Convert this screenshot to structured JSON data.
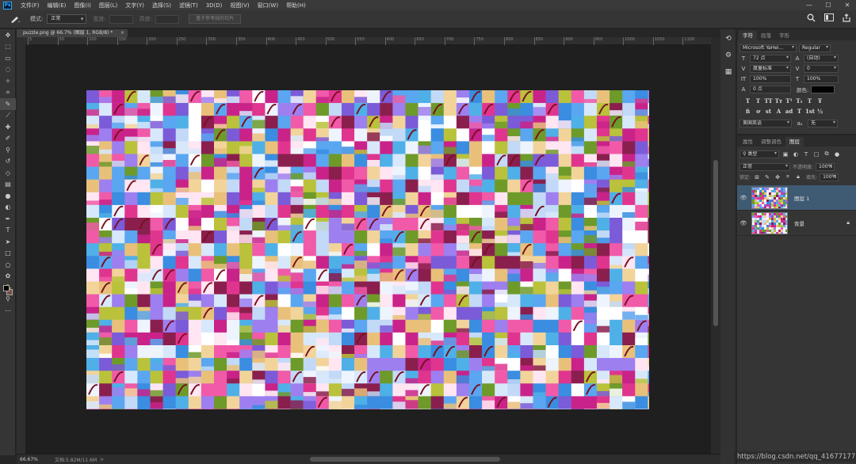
{
  "app": {
    "logo": "Ps"
  },
  "menu": [
    "文件(F)",
    "编辑(E)",
    "图像(I)",
    "图层(L)",
    "文字(Y)",
    "选择(S)",
    "滤镜(T)",
    "3D(D)",
    "视图(V)",
    "窗口(W)",
    "帮助(H)"
  ],
  "window_controls": {
    "minimize": "—",
    "maximize": "☐",
    "close": "✕"
  },
  "options": {
    "mode_label": "模式:",
    "mode_value": "正常",
    "width_label": "宽度:",
    "height_label": "高度:",
    "slices_button": "基于参考线的切片"
  },
  "document": {
    "tab_title": "puzzle.png @ 66.7% (图层 1, RGB/8) *",
    "tab_close": "×"
  },
  "ruler": {
    "h_ticks": [
      "5",
      "50",
      "100",
      "150",
      "200",
      "250",
      "300",
      "350",
      "400",
      "450",
      "500",
      "550",
      "600",
      "650",
      "700",
      "750",
      "800",
      "850",
      "900",
      "950",
      "1000",
      "1050",
      "1100"
    ]
  },
  "status": {
    "zoom": "66.67%",
    "doc_info": "文档:5.82M/11.6M",
    "arrow": ">"
  },
  "character": {
    "tabs": [
      "字符",
      "段落",
      "字形"
    ],
    "font_family": "Microsoft YaHei...",
    "font_style": "Regular",
    "font_size": "72 点",
    "leading": "(自动)",
    "kerning": "度量标准",
    "tracking": "0",
    "vscale": "100%",
    "hscale": "100%",
    "baseline": "0 点",
    "color_label": "颜色:",
    "language": "美国英语",
    "aa_label": "aₐ",
    "aa_value": "无",
    "type_buttons": [
      "T",
      "T",
      "TT",
      "Tт",
      "T¹",
      "T₁",
      "T",
      "Ŧ"
    ],
    "opentype_buttons": [
      "ﬁ",
      "ơ",
      "st",
      "A",
      "ad",
      "T",
      "1st",
      "½"
    ]
  },
  "layers": {
    "tabs": [
      "属性",
      "调整调色",
      "图层"
    ],
    "filter_label": "类型",
    "blend_mode": "正常",
    "opacity_label": "不透明度:",
    "opacity_value": "100%",
    "lock_label": "锁定:",
    "fill_label": "填充:",
    "fill_value": "100%",
    "items": [
      {
        "name": "图层 1",
        "selected": true,
        "locked": false
      },
      {
        "name": "背景",
        "selected": false,
        "locked": true
      }
    ]
  },
  "watermark": "https://blog.csdn.net/qq_41677177",
  "colors": {
    "foreground": "#000000",
    "background": "#7a4e46",
    "selected_layer": "#3f5a73",
    "ps_blue": "#31a8ff"
  }
}
